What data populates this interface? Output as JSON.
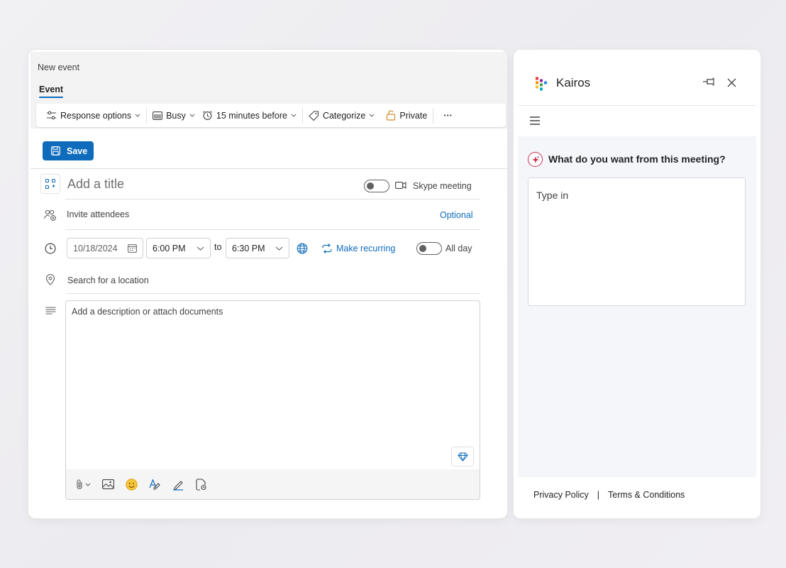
{
  "event_window": {
    "title": "New event",
    "tab": "Event",
    "toolbar": {
      "response_options": "Response options",
      "busy": "Busy",
      "reminder": "15 minutes before",
      "categorize": "Categorize",
      "private": "Private",
      "more": "···"
    },
    "save_label": "Save",
    "title_placeholder": "Add a title",
    "skype_meeting": "Skype meeting",
    "invite_placeholder": "Invite attendees",
    "optional_label": "Optional",
    "date": "10/18/2024",
    "start_time": "6:00 PM",
    "to_label": "to",
    "end_time": "6:30 PM",
    "make_recurring": "Make recurring",
    "all_day": "All day",
    "location_placeholder": "Search for a location",
    "description_placeholder": "Add a description or attach documents",
    "accent_color": "#0f6cbd"
  },
  "kairos": {
    "title": "Kairos",
    "question": "What do you want from this meeting?",
    "input_placeholder": "Type in",
    "footer": {
      "privacy": "Privacy Policy",
      "separator": "|",
      "terms": "Terms & Conditions"
    }
  }
}
